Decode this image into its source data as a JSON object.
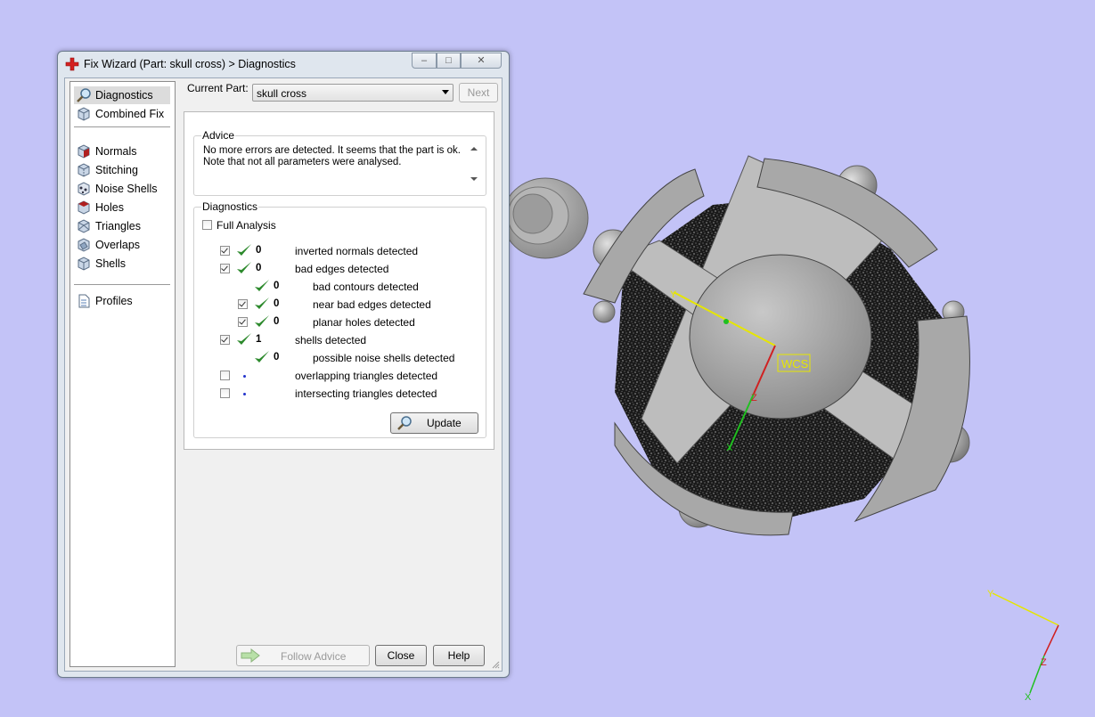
{
  "window": {
    "title": "Fix Wizard (Part: skull cross) > Diagnostics",
    "controls": {
      "minimize": "–",
      "maximize": "□",
      "close": "✕"
    }
  },
  "nav": {
    "items": [
      {
        "label": "Diagnostics",
        "icon": "magnifier-icon",
        "selected": true
      },
      {
        "label": "Combined Fix",
        "icon": "cube-icon"
      },
      {
        "label": "Normals",
        "icon": "normals-cube-icon"
      },
      {
        "label": "Stitching",
        "icon": "stitching-cube-icon"
      },
      {
        "label": "Noise Shells",
        "icon": "noise-shells-icon"
      },
      {
        "label": "Holes",
        "icon": "holes-cube-icon"
      },
      {
        "label": "Triangles",
        "icon": "triangles-cube-icon"
      },
      {
        "label": "Overlaps",
        "icon": "overlaps-cube-icon"
      },
      {
        "label": "Shells",
        "icon": "shells-cube-icon"
      },
      {
        "label": "Profiles",
        "icon": "profile-document-icon"
      }
    ]
  },
  "current_part": {
    "label": "Current Part:",
    "value": "skull cross",
    "next_label": "Next"
  },
  "advice": {
    "title": "Advice",
    "line1": "No more errors are detected. It seems that the part is ok.",
    "line2": "Note that not all parameters were analysed."
  },
  "diagnostics": {
    "title": "Diagnostics",
    "full_analysis_label": "Full Analysis",
    "rows": [
      {
        "checked": true,
        "status": "ok",
        "count": "0",
        "label": "inverted normals detected"
      },
      {
        "checked": true,
        "status": "ok",
        "count": "0",
        "label": "bad edges detected"
      },
      {
        "checked": null,
        "status": "ok",
        "count": "0",
        "label": "bad contours detected"
      },
      {
        "checked": true,
        "status": "ok",
        "count": "0",
        "label": "near bad edges detected"
      },
      {
        "checked": true,
        "status": "ok",
        "count": "0",
        "label": "planar holes detected"
      },
      {
        "checked": true,
        "status": "ok",
        "count": "1",
        "label": "shells detected"
      },
      {
        "checked": null,
        "status": "ok",
        "count": "0",
        "label": "possible noise shells detected"
      },
      {
        "checked": false,
        "status": "pending",
        "count": "",
        "label": "overlapping triangles detected"
      },
      {
        "checked": false,
        "status": "pending",
        "count": "",
        "label": "intersecting triangles detected"
      }
    ],
    "update_label": "Update"
  },
  "footer": {
    "follow_advice_label": "Follow Advice",
    "close_label": "Close",
    "help_label": "Help"
  },
  "viewport": {
    "wcs_label": "WCS",
    "axis_y": "Y",
    "axis_z": "Z",
    "axis_x": "X"
  },
  "colors": {
    "background": "#c3c3f7",
    "check_green": "#2d8a2d",
    "axis_x": "#20c020",
    "axis_y": "#e6e600",
    "axis_z": "#d02020"
  }
}
